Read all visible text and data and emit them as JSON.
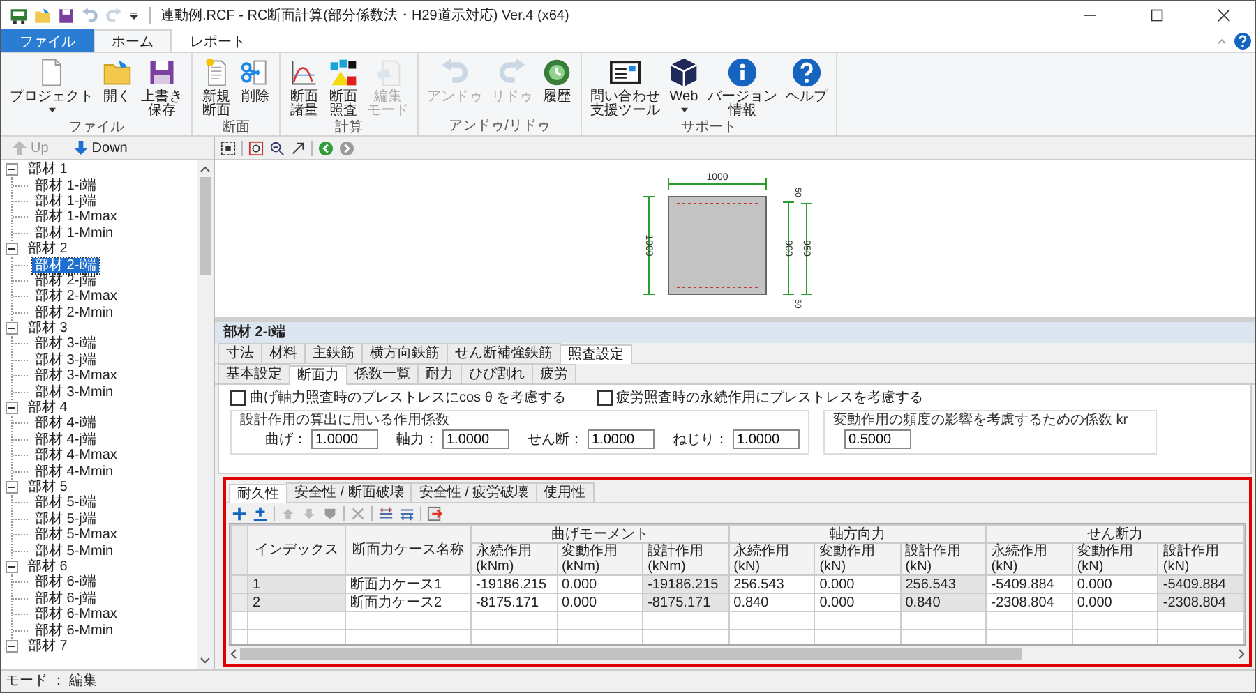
{
  "window": {
    "title": "連動例.RCF - RC断面計算(部分係数法・H29道示対応) Ver.4 (x64)"
  },
  "ribbon": {
    "tabs": [
      {
        "label": "ファイル",
        "kind": "file",
        "selected": false
      },
      {
        "label": "ホーム",
        "kind": "tab",
        "selected": true
      },
      {
        "label": "レポート",
        "kind": "tab",
        "selected": false
      }
    ],
    "groups": [
      {
        "label": "ファイル",
        "buttons": [
          {
            "lines": [
              "プロジェクト"
            ],
            "dropdown": true,
            "disabled": false
          },
          {
            "lines": [
              "開く"
            ],
            "dropdown": false,
            "disabled": false
          },
          {
            "lines": [
              "上書き",
              "保存"
            ],
            "dropdown": false,
            "disabled": false
          }
        ]
      },
      {
        "label": "断面",
        "buttons": [
          {
            "lines": [
              "新規",
              "断面"
            ],
            "dropdown": false,
            "disabled": false
          },
          {
            "lines": [
              "削除"
            ],
            "dropdown": false,
            "disabled": false
          }
        ]
      },
      {
        "label": "計算",
        "buttons": [
          {
            "lines": [
              "断面",
              "諸量"
            ],
            "dropdown": false,
            "disabled": false
          },
          {
            "lines": [
              "断面",
              "照査"
            ],
            "dropdown": false,
            "disabled": false
          },
          {
            "lines": [
              "編集",
              "モード"
            ],
            "dropdown": false,
            "disabled": true
          }
        ]
      },
      {
        "label": "アンドゥ/リドゥ",
        "buttons": [
          {
            "lines": [
              "アンドゥ"
            ],
            "dropdown": false,
            "disabled": true
          },
          {
            "lines": [
              "リドゥ"
            ],
            "dropdown": false,
            "disabled": true
          },
          {
            "lines": [
              "履歴"
            ],
            "dropdown": false,
            "disabled": false
          }
        ]
      },
      {
        "label": "サポート",
        "buttons": [
          {
            "lines": [
              "問い合わせ",
              "支援ツール"
            ],
            "dropdown": false,
            "disabled": false
          },
          {
            "lines": [
              "Web"
            ],
            "dropdown": true,
            "disabled": false
          },
          {
            "lines": [
              "バージョン",
              "情報"
            ],
            "dropdown": false,
            "disabled": false
          },
          {
            "lines": [
              "ヘルプ"
            ],
            "dropdown": false,
            "disabled": false
          }
        ]
      }
    ]
  },
  "nav": {
    "buttons": [
      {
        "label": "Up",
        "disabled": true
      },
      {
        "label": "Down",
        "disabled": false
      }
    ]
  },
  "tree": {
    "items": [
      {
        "label": "部材 1",
        "expanded": true,
        "children": [
          {
            "label": "部材 1-i端",
            "selected": false
          },
          {
            "label": "部材 1-j端",
            "selected": false
          },
          {
            "label": "部材 1-Mmax",
            "selected": false
          },
          {
            "label": "部材 1-Mmin",
            "selected": false
          }
        ]
      },
      {
        "label": "部材 2",
        "expanded": true,
        "children": [
          {
            "label": "部材 2-i端",
            "selected": true
          },
          {
            "label": "部材 2-j端",
            "selected": false
          },
          {
            "label": "部材 2-Mmax",
            "selected": false
          },
          {
            "label": "部材 2-Mmin",
            "selected": false
          }
        ]
      },
      {
        "label": "部材 3",
        "expanded": true,
        "children": [
          {
            "label": "部材 3-i端",
            "selected": false
          },
          {
            "label": "部材 3-j端",
            "selected": false
          },
          {
            "label": "部材 3-Mmax",
            "selected": false
          },
          {
            "label": "部材 3-Mmin",
            "selected": false
          }
        ]
      },
      {
        "label": "部材 4",
        "expanded": true,
        "children": [
          {
            "label": "部材 4-i端",
            "selected": false
          },
          {
            "label": "部材 4-j端",
            "selected": false
          },
          {
            "label": "部材 4-Mmax",
            "selected": false
          },
          {
            "label": "部材 4-Mmin",
            "selected": false
          }
        ]
      },
      {
        "label": "部材 5",
        "expanded": true,
        "children": [
          {
            "label": "部材 5-i端",
            "selected": false
          },
          {
            "label": "部材 5-j端",
            "selected": false
          },
          {
            "label": "部材 5-Mmax",
            "selected": false
          },
          {
            "label": "部材 5-Mmin",
            "selected": false
          }
        ]
      },
      {
        "label": "部材 6",
        "expanded": true,
        "children": [
          {
            "label": "部材 6-i端",
            "selected": false
          },
          {
            "label": "部材 6-j端",
            "selected": false
          },
          {
            "label": "部材 6-Mmax",
            "selected": false
          },
          {
            "label": "部材 6-Mmin",
            "selected": false
          }
        ]
      },
      {
        "label": "部材 7",
        "expanded": true
      }
    ]
  },
  "cross_section": {
    "width_label": "1000",
    "height_label": "1000",
    "inner_label": "900",
    "outer_label": "950",
    "top_cover_label": "50",
    "bottom_cover_label": "50"
  },
  "section": {
    "title": "部材 2-i端",
    "tabs": [
      {
        "label": "寸法",
        "selected": false
      },
      {
        "label": "材料",
        "selected": false
      },
      {
        "label": "主鉄筋",
        "selected": false
      },
      {
        "label": "横方向鉄筋",
        "selected": false
      },
      {
        "label": "せん断補強鉄筋",
        "selected": false
      },
      {
        "label": "照査設定",
        "selected": true
      }
    ],
    "subtabs": [
      {
        "label": "基本設定",
        "selected": false
      },
      {
        "label": "断面力",
        "selected": true
      },
      {
        "label": "係数一覧",
        "selected": false
      },
      {
        "label": "耐力",
        "selected": false
      },
      {
        "label": "ひび割れ",
        "selected": false
      },
      {
        "label": "疲労",
        "selected": false
      }
    ],
    "options": [
      {
        "label": "曲げ軸力照査時のプレストレスにcos θ を考慮する",
        "checked": false
      },
      {
        "label": "疲労照査時の永続作用にプレストレスを考慮する",
        "checked": false
      }
    ],
    "factor_group": {
      "label": "設計作用の算出に用いる作用係数",
      "fields": [
        {
          "label": "曲げ：",
          "value": "1.0000"
        },
        {
          "label": "軸力：",
          "value": "1.0000"
        },
        {
          "label": "せん断：",
          "value": "1.0000"
        },
        {
          "label": "ねじり：",
          "value": "1.0000"
        }
      ]
    },
    "kr_group": {
      "label": "変動作用の頻度の影響を考慮するための係数 kr",
      "value": "0.5000"
    }
  },
  "check_tabs": [
    {
      "label": "耐久性",
      "selected": true
    },
    {
      "label": "安全性 / 断面破壊",
      "selected": false
    },
    {
      "label": "安全性 / 疲労破壊",
      "selected": false
    },
    {
      "label": "使用性",
      "selected": false
    }
  ],
  "table": {
    "fixed_columns": [
      "インデックス",
      "断面力ケース名称"
    ],
    "groups": [
      {
        "label": "曲げモーメント",
        "columns": [
          {
            "label": "永続作用 (kNm)",
            "computed": false
          },
          {
            "label": "変動作用 (kNm)",
            "computed": false
          },
          {
            "label": "設計作用 (kNm)",
            "computed": true
          }
        ]
      },
      {
        "label": "軸方向力",
        "columns": [
          {
            "label": "永続作用 (kN)",
            "computed": false
          },
          {
            "label": "変動作用 (kN)",
            "computed": false
          },
          {
            "label": "設計作用 (kN)",
            "computed": true
          }
        ]
      },
      {
        "label": "せん断力",
        "columns": [
          {
            "label": "永続作用 (kN)",
            "computed": false
          },
          {
            "label": "変動作用 (kN)",
            "computed": false
          },
          {
            "label": "設計作用 (kN)",
            "computed": true
          }
        ]
      }
    ],
    "rows": [
      {
        "index": "1",
        "name": "断面力ケース1",
        "values": [
          "-19186.215",
          "0.000",
          "-19186.215",
          "256.543",
          "0.000",
          "256.543",
          "-5409.884",
          "0.000",
          "-5409.884"
        ]
      },
      {
        "index": "2",
        "name": "断面力ケース2",
        "values": [
          "-8175.171",
          "0.000",
          "-8175.171",
          "0.840",
          "0.000",
          "0.840",
          "-2308.804",
          "0.000",
          "-2308.804"
        ]
      }
    ]
  },
  "status_bar": {
    "text": "モード ： 編集"
  }
}
